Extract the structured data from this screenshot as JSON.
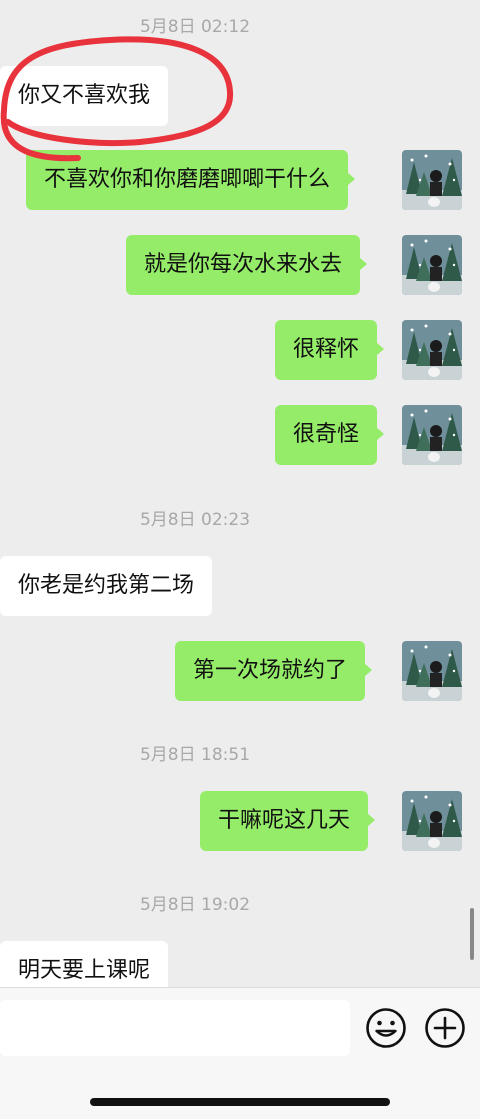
{
  "chat": {
    "timestamps": [
      "5月8日 02:12",
      "5月8日 02:23",
      "5月8日 18:51",
      "5月8日 19:02"
    ],
    "messages": [
      {
        "side": "in",
        "text": "你又不喜欢我"
      },
      {
        "side": "out",
        "text": "不喜欢你和你磨磨唧唧干什么"
      },
      {
        "side": "out",
        "text": "就是你每次水来水去"
      },
      {
        "side": "out",
        "text": "很释怀"
      },
      {
        "side": "out",
        "text": "很奇怪"
      },
      {
        "side": "in",
        "text": "你老是约我第二场"
      },
      {
        "side": "out",
        "text": "第一次场就约了"
      },
      {
        "side": "out",
        "text": "干嘛呢这几天"
      },
      {
        "side": "in",
        "text": "明天要上课呢"
      }
    ]
  },
  "input_bar": {
    "icons": [
      "emoji-icon",
      "plus-icon"
    ]
  },
  "colors": {
    "background": "#ededed",
    "incoming_bubble": "#ffffff",
    "outgoing_bubble": "#95ec69",
    "annotation_red": "#e8333c"
  }
}
